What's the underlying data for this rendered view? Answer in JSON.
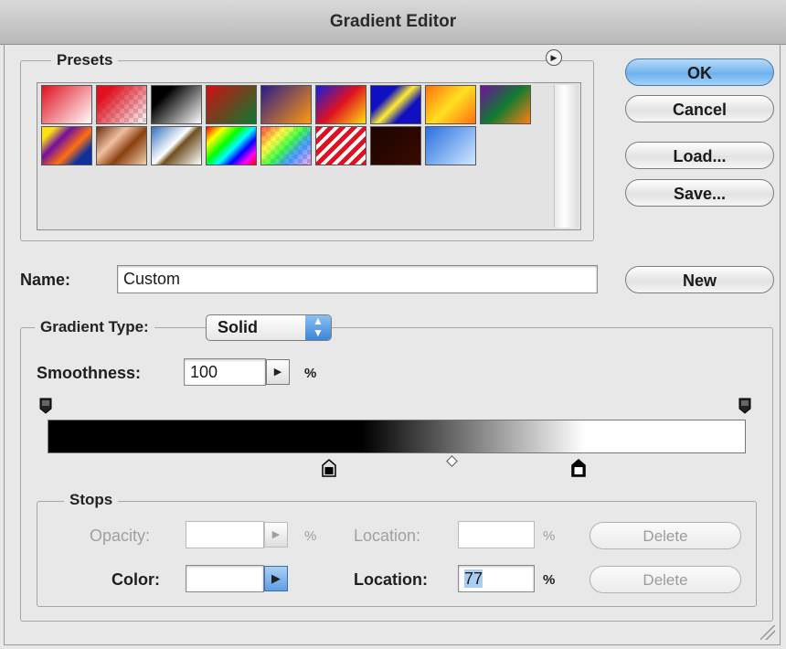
{
  "window": {
    "title": "Gradient Editor"
  },
  "presets": {
    "label": "Presets",
    "menu_icon": "circle-right-arrow-icon",
    "swatches": [
      {
        "name": "foreground-to-background",
        "fill": "linear-gradient(135deg,#e01020,#ffffff)"
      },
      {
        "name": "foreground-to-transparent",
        "fill": "linear-gradient(135deg,#e01020 20%,rgba(255,255,255,0.2)), repeating-conic-gradient(#cccccc 0 25%,#ffffff 0 50%) 0 0/10px 10px"
      },
      {
        "name": "black-white",
        "fill": "linear-gradient(135deg,#000000 25%,#ffffff)"
      },
      {
        "name": "red-green",
        "fill": "linear-gradient(135deg,#d01010,#0a7a30)"
      },
      {
        "name": "violet-orange",
        "fill": "linear-gradient(135deg,#2a1a8a,#ff9a10)"
      },
      {
        "name": "blue-red-yellow",
        "fill": "linear-gradient(135deg,#1020e0,#e01020 50%,#ffe010)"
      },
      {
        "name": "blue-yellow-blue",
        "fill": "linear-gradient(135deg,#1010c0 30%,#ffee30 50%,#1010c0 70%)"
      },
      {
        "name": "orange-yellow-orange",
        "fill": "linear-gradient(135deg,#ff7010,#ffe020 50%,#ff7010)"
      },
      {
        "name": "violet-green-orange",
        "fill": "linear-gradient(135deg,#7010a0,#107a30 50%,#ff8010)"
      },
      {
        "name": "yellow-violet-orange-blue",
        "fill": "linear-gradient(135deg,#ffe010 15%,#7010a0 35%,#ff7010 60%,#1030a0 80%)"
      },
      {
        "name": "copper",
        "fill": "linear-gradient(135deg,#6a3010,#f0c0a0 35%,#8a4010 60%,#f0d0b0)"
      },
      {
        "name": "chrome",
        "fill": "linear-gradient(135deg,#3070c0,#ffffff 45%,#705020 55%,#ffffff)"
      },
      {
        "name": "spectrum",
        "fill": "linear-gradient(135deg,#ff0000,#ffff00 20%,#00ff00 40%,#00ffff 55%,#0000ff 70%,#ff00ff 85%,#ff0000)"
      },
      {
        "name": "transparent-rainbow",
        "fill": "linear-gradient(135deg,rgba(255,0,0,0.7),rgba(255,255,0,0.7) 30%,rgba(0,255,0,0.7) 50%,rgba(0,120,255,0.7) 70%,rgba(255,0,255,0.3)), repeating-conic-gradient(#cccccc 0 25%,#ffffff 0 50%) 0 0/10px 10px"
      },
      {
        "name": "transparent-stripes",
        "fill": "repeating-linear-gradient(135deg,#e01020 0 5px,#ffffff 5px 9px)"
      },
      {
        "name": "dark-brown",
        "fill": "linear-gradient(135deg,#1a0500,#3a0a00)"
      },
      {
        "name": "light-blue",
        "fill": "linear-gradient(135deg,#2a70e0,#d0e8ff)"
      }
    ]
  },
  "buttons": {
    "ok": "OK",
    "cancel": "Cancel",
    "load": "Load...",
    "save": "Save...",
    "new": "New"
  },
  "name_field": {
    "label": "Name:",
    "value": "Custom"
  },
  "gradient_type": {
    "label": "Gradient Type:",
    "selected": "Solid",
    "stepper_icon": "up-down-chevron-icon"
  },
  "smoothness": {
    "label": "Smoothness:",
    "value": "100",
    "unit": "%",
    "arrow_icon": "right-triangle-icon"
  },
  "gradient": {
    "colors": {
      "start": "#000000",
      "end": "#ffffff"
    },
    "color_stops_locations_percent": [
      39,
      77
    ],
    "midpoint_percent": 58
  },
  "stops": {
    "label": "Stops",
    "opacity_label": "Opacity:",
    "opacity_value": "",
    "opacity_unit": "%",
    "opacity_location_label": "Location:",
    "opacity_location_value": "",
    "opacity_location_unit": "%",
    "delete_opacity": "Delete",
    "color_label": "Color:",
    "color_value": "#ffffff",
    "color_location_label": "Location:",
    "color_location_value": "77",
    "color_location_unit": "%",
    "delete_color": "Delete"
  }
}
